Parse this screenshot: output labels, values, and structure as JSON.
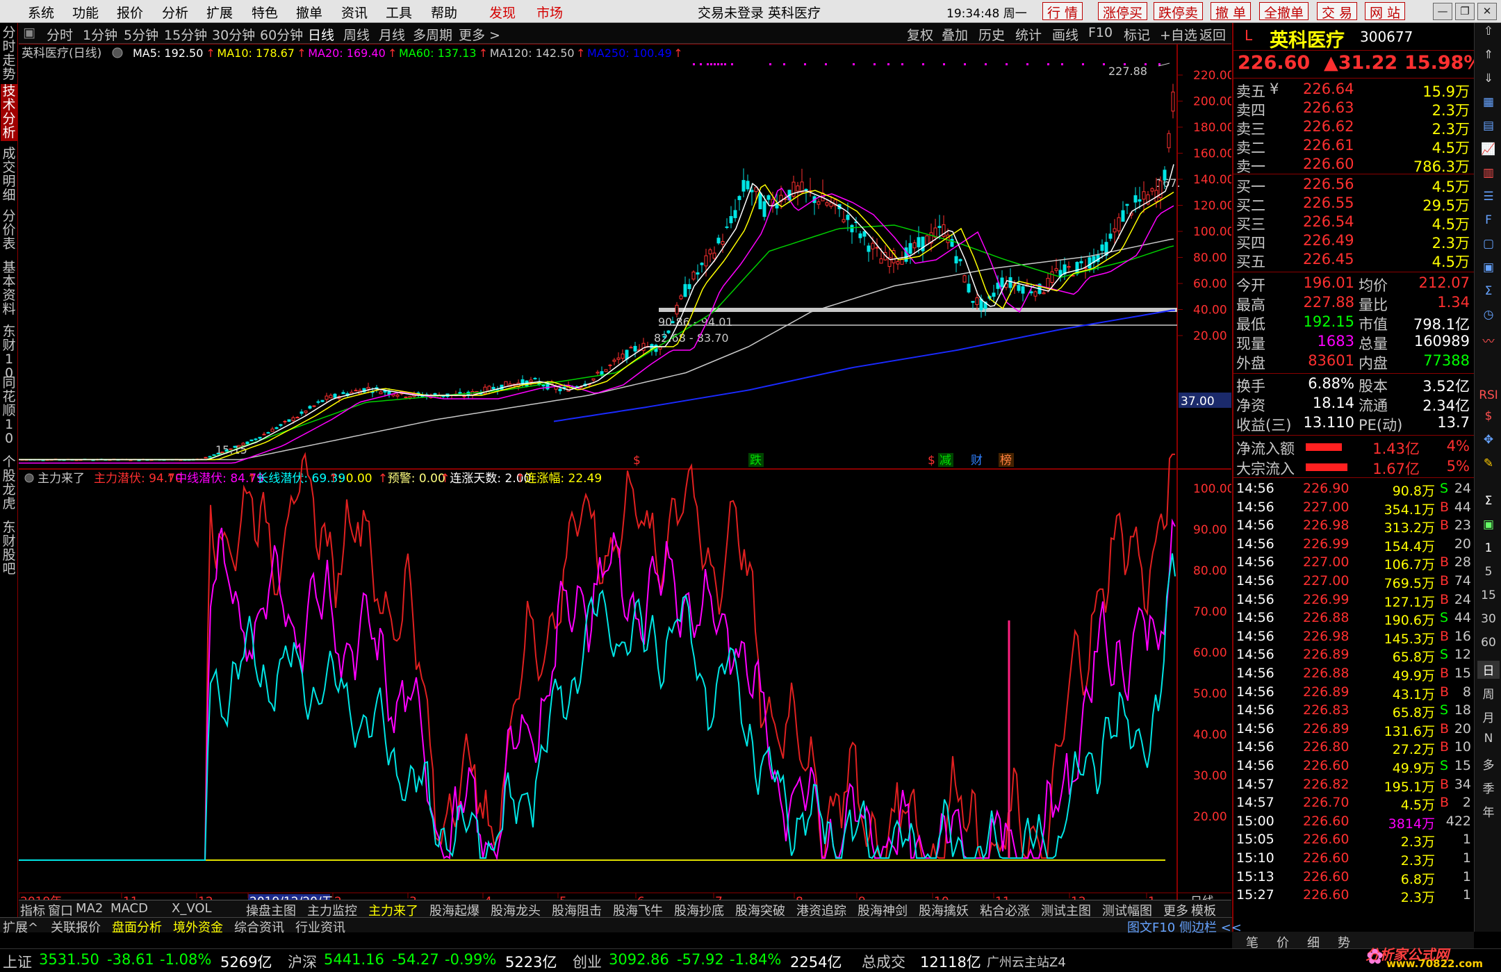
{
  "menubar": {
    "items": [
      "系统",
      "功能",
      "报价",
      "分析",
      "扩展",
      "特色",
      "撤单",
      "资讯",
      "工具",
      "帮助"
    ],
    "red_items": [
      "发现",
      "市场"
    ],
    "center_title": "交易未登录 英科医疗",
    "time": "19:34:48 周一",
    "right_buttons": [
      "行 情",
      "涨停买",
      "跌停卖",
      "撤 单",
      "全撤单",
      "交 易",
      "网 站"
    ]
  },
  "left_tabs": [
    "分时走势",
    "技术分析",
    "成交明细",
    "分价表",
    "基本资料",
    "东财10",
    "同花顺10",
    "个股龙虎",
    "东财股吧"
  ],
  "left_tab_active": "技术分析",
  "toolbar": {
    "periods": [
      "分时",
      "1分钟",
      "5分钟",
      "15分钟",
      "30分钟",
      "60分钟",
      "日线",
      "周线",
      "月线",
      "多周期",
      "更多 >"
    ],
    "selected": "日线",
    "right": [
      "复权",
      "叠加",
      "历史",
      "统计",
      "画线",
      "F10",
      "标记",
      "+自选",
      "返回"
    ]
  },
  "chart": {
    "header": {
      "name": "英科医疗(日线)",
      "ma": [
        {
          "label": "MA5: 192.50",
          "color": "#ffffff"
        },
        {
          "label": "MA10: 178.67",
          "color": "#ffff00"
        },
        {
          "label": "MA20: 169.40",
          "color": "#ff00ff"
        },
        {
          "label": "MA60: 137.13",
          "color": "#00ff00"
        },
        {
          "label": "MA120: 142.50",
          "color": "#c8c8c8"
        },
        {
          "label": "MA250: 100.49",
          "color": "#0000ff"
        }
      ]
    },
    "y_labels": [
      "220.00",
      "200.00",
      "180.00",
      "160.00",
      "140.00",
      "120.00",
      "100.00",
      "80.00",
      "60.00",
      "40.00",
      "20.00"
    ],
    "price_marker": "37.00",
    "annotations": {
      "high": "227.88",
      "low": "15.15",
      "band1": "90.86 - 94.01",
      "band2": "82.68 - 83.70",
      "ma_end": "167."
    },
    "event_markers": [
      {
        "text": "$",
        "color": "#ff3030"
      },
      {
        "text": "跌",
        "color": "#00c000"
      },
      {
        "text": "$",
        "color": "#ff3030"
      },
      {
        "text": "减",
        "color": "#00c000"
      },
      {
        "text": "财",
        "color": "#3080ff"
      },
      {
        "text": "榜",
        "color": "#ff8040"
      }
    ],
    "indicator": {
      "name": "主力来了",
      "values": [
        {
          "label": "主力潜伏: 94.70",
          "color": "#ff3030"
        },
        {
          "label": "中线潜伏: 84.79",
          "color": "#ff00ff"
        },
        {
          "label": "长线潜伏: 69.39",
          "color": "#00ffff"
        },
        {
          "label": ": 0.00",
          "color": "#ffff00"
        },
        {
          "label": "预警: 0.00",
          "color": "#ffff80"
        },
        {
          "label": "连涨天数: 2.00",
          "color": "#ffffff"
        },
        {
          "label": "连涨幅: 22.49",
          "color": "#ffff00"
        }
      ],
      "y_labels": [
        "100.00",
        "90.00",
        "80.00",
        "70.00",
        "60.00",
        "50.00",
        "40.00",
        "30.00",
        "20.00"
      ]
    },
    "x_axis": [
      "2019年",
      "11",
      "12",
      "2019/12/20/五",
      "2",
      "3",
      "4",
      "5",
      "6",
      "7",
      "8",
      "9",
      "10",
      "11",
      "12",
      "1"
    ],
    "period_label": "日线"
  },
  "tabs1": [
    "指标",
    "窗口",
    "MA2",
    "MACD",
    "X_VOL",
    "操盘主图",
    "主力监控",
    "主力来了",
    "股海起爆",
    "股海龙头",
    "股海阻击",
    "股海飞牛",
    "股海抄底",
    "股海突破",
    "港资追踪",
    "股海神剑",
    "股海擒妖",
    "粘合必涨",
    "测试主图",
    "测试幅图",
    "更多",
    "模板"
  ],
  "tabs1_active": "主力来了",
  "tabs2": [
    "扩展^",
    "关联报价",
    "盘面分析",
    "境外资金",
    "综合资讯",
    "行业资讯"
  ],
  "tabs2_right": "图文F10 侧边栏 <<",
  "quote": {
    "code_prefix": "L",
    "name": "英科医疗",
    "code": "300677",
    "price": "226.60",
    "change": "▲31.22",
    "pct": "15.98%",
    "sells": [
      {
        "label": "卖五",
        "price": "226.64",
        "vol": "15.9万"
      },
      {
        "label": "卖四",
        "price": "226.63",
        "vol": "2.3万"
      },
      {
        "label": "卖三",
        "price": "226.62",
        "vol": "2.3万"
      },
      {
        "label": "卖二",
        "price": "226.61",
        "vol": "4.5万"
      },
      {
        "label": "卖一",
        "price": "226.60",
        "vol": "786.3万"
      }
    ],
    "sell5_mark": "¥",
    "buys": [
      {
        "label": "买一",
        "price": "226.56",
        "vol": "4.5万"
      },
      {
        "label": "买二",
        "price": "226.55",
        "vol": "29.5万"
      },
      {
        "label": "买三",
        "price": "226.54",
        "vol": "4.5万"
      },
      {
        "label": "买四",
        "price": "226.49",
        "vol": "2.3万"
      },
      {
        "label": "买五",
        "price": "226.45",
        "vol": "4.5万"
      }
    ],
    "stats": [
      {
        "l1": "今开",
        "v1": "196.01",
        "c1": "#ff3030",
        "l2": "均价",
        "v2": "212.07",
        "c2": "#ff3030"
      },
      {
        "l1": "最高",
        "v1": "227.88",
        "c1": "#ff3030",
        "l2": "量比",
        "v2": "1.34",
        "c2": "#ff3030"
      },
      {
        "l1": "最低",
        "v1": "192.15",
        "c1": "#00ff00",
        "l2": "市值",
        "v2": "798.1亿",
        "c2": "#ffffff"
      },
      {
        "l1": "现量",
        "v1": "1683",
        "c1": "#ff00ff",
        "l2": "总量",
        "v2": "160989",
        "c2": "#ffffff"
      },
      {
        "l1": "外盘",
        "v1": "83601",
        "c1": "#ff3030",
        "l2": "内盘",
        "v2": "77388",
        "c2": "#00ff00"
      }
    ],
    "stats2": [
      {
        "l1": "换手",
        "v1": "6.88%",
        "l2": "股本",
        "v2": "3.52亿"
      },
      {
        "l1": "净资",
        "v1": "18.14",
        "l2": "流通",
        "v2": "2.34亿"
      },
      {
        "l1": "收益(三)",
        "v1": "13.110",
        "l2": "PE(动)",
        "v2": "13.7"
      }
    ],
    "flows": [
      {
        "label": "净流入额",
        "value": "1.43亿",
        "pct": "4%",
        "fill": 0.65
      },
      {
        "label": "大宗流入",
        "value": "1.67亿",
        "pct": "5%",
        "fill": 0.75
      }
    ],
    "ticks": [
      {
        "t": "14:56",
        "p": "226.90",
        "v": "90.8万",
        "s": "S",
        "n": "24"
      },
      {
        "t": "14:56",
        "p": "227.00",
        "v": "354.1万",
        "s": "B",
        "n": "44"
      },
      {
        "t": "14:56",
        "p": "226.98",
        "v": "313.2万",
        "s": "B",
        "n": "23"
      },
      {
        "t": "14:56",
        "p": "226.99",
        "v": "154.4万",
        "s": "",
        "n": "20"
      },
      {
        "t": "14:56",
        "p": "227.00",
        "v": "106.7万",
        "s": "B",
        "n": "28"
      },
      {
        "t": "14:56",
        "p": "227.00",
        "v": "769.5万",
        "s": "B",
        "n": "74"
      },
      {
        "t": "14:56",
        "p": "226.99",
        "v": "127.1万",
        "s": "B",
        "n": "24"
      },
      {
        "t": "14:56",
        "p": "226.88",
        "v": "190.6万",
        "s": "S",
        "n": "44"
      },
      {
        "t": "14:56",
        "p": "226.98",
        "v": "145.3万",
        "s": "B",
        "n": "16"
      },
      {
        "t": "14:56",
        "p": "226.89",
        "v": "65.8万",
        "s": "S",
        "n": "12"
      },
      {
        "t": "14:56",
        "p": "226.88",
        "v": "49.9万",
        "s": "B",
        "n": "15"
      },
      {
        "t": "14:56",
        "p": "226.89",
        "v": "43.1万",
        "s": "B",
        "n": "8"
      },
      {
        "t": "14:56",
        "p": "226.83",
        "v": "65.8万",
        "s": "S",
        "n": "18"
      },
      {
        "t": "14:56",
        "p": "226.89",
        "v": "131.6万",
        "s": "B",
        "n": "20"
      },
      {
        "t": "14:56",
        "p": "226.80",
        "v": "27.2万",
        "s": "B",
        "n": "10"
      },
      {
        "t": "14:56",
        "p": "226.60",
        "v": "49.9万",
        "s": "S",
        "n": "15"
      },
      {
        "t": "14:57",
        "p": "226.82",
        "v": "195.1万",
        "s": "B",
        "n": "34"
      },
      {
        "t": "14:57",
        "p": "226.70",
        "v": "4.5万",
        "s": "B",
        "n": "2"
      },
      {
        "t": "15:00",
        "p": "226.60",
        "v": "3814万",
        "s": "",
        "n": "422"
      },
      {
        "t": "15:05",
        "p": "226.60",
        "v": "2.3万",
        "s": "",
        "n": "1"
      },
      {
        "t": "15:10",
        "p": "226.60",
        "v": "2.3万",
        "s": "",
        "n": "1"
      },
      {
        "t": "15:13",
        "p": "226.60",
        "v": "6.8万",
        "s": "",
        "n": "1"
      },
      {
        "t": "15:27",
        "p": "226.60",
        "v": "2.3万",
        "s": "",
        "n": "1"
      }
    ],
    "bottom_tabs": [
      "笔",
      "价",
      "细",
      "势"
    ]
  },
  "right_col": [
    "5",
    "15",
    "30",
    "60",
    "日",
    "周",
    "月",
    "N",
    "多",
    "季",
    "年",
    "RSI"
  ],
  "status": [
    {
      "name": "上证",
      "val": "3531.50",
      "chg": "-38.61",
      "pct": "-1.08%",
      "amt": "5269亿"
    },
    {
      "name": "沪深",
      "val": "5441.16",
      "chg": "-54.27",
      "pct": "-0.99%",
      "amt": "5223亿"
    },
    {
      "name": "创业",
      "val": "3092.86",
      "chg": "-57.92",
      "pct": "-1.84%",
      "amt": "2254亿"
    }
  ],
  "status_total": "总成交",
  "status_total_val": "12118亿",
  "status_site": "广州云主站Z4",
  "watermark": "分析家公式网",
  "watermark_url": "www.70822.com"
}
